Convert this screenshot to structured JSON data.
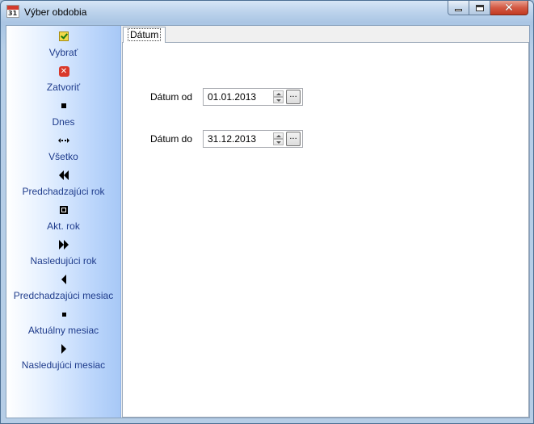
{
  "window": {
    "title": "Výber obdobia",
    "icon": "calendar-icon",
    "icon_text": "31",
    "controls": {
      "minimize": "minimize-icon",
      "maximize": "maximize-icon",
      "close": "close-icon"
    }
  },
  "sidebar": {
    "items": [
      {
        "label": "Vybrať",
        "icon": "checkmark-icon"
      },
      {
        "label": "Zatvoriť",
        "icon": "close-icon"
      },
      {
        "label": "Dnes",
        "icon": "square-icon"
      },
      {
        "label": "Všetko",
        "icon": "expand-arrows-icon"
      },
      {
        "label": "Predchadzajúci rok",
        "icon": "double-left-arrow-icon"
      },
      {
        "label": "Akt. rok",
        "icon": "framed-square-icon"
      },
      {
        "label": "Nasledujúci rok",
        "icon": "double-right-arrow-icon"
      },
      {
        "label": "Predchadzajúci mesiac",
        "icon": "left-arrow-icon"
      },
      {
        "label": "Aktuálny mesiac",
        "icon": "small-square-icon"
      },
      {
        "label": "Nasledujúci mesiac",
        "icon": "right-arrow-icon"
      }
    ]
  },
  "tabs": [
    {
      "label": "Dátum",
      "active": true
    }
  ],
  "form": {
    "date_from": {
      "label": "Dátum od",
      "value": "01.01.2013",
      "button": "..."
    },
    "date_to": {
      "label": "Dátum do",
      "value": "31.12.2013",
      "button": "..."
    }
  },
  "colors": {
    "sidebar_text": "#1f3c8c",
    "close_button": "#d45a44",
    "sidebar_gradient_end": "#a7c8f6"
  }
}
